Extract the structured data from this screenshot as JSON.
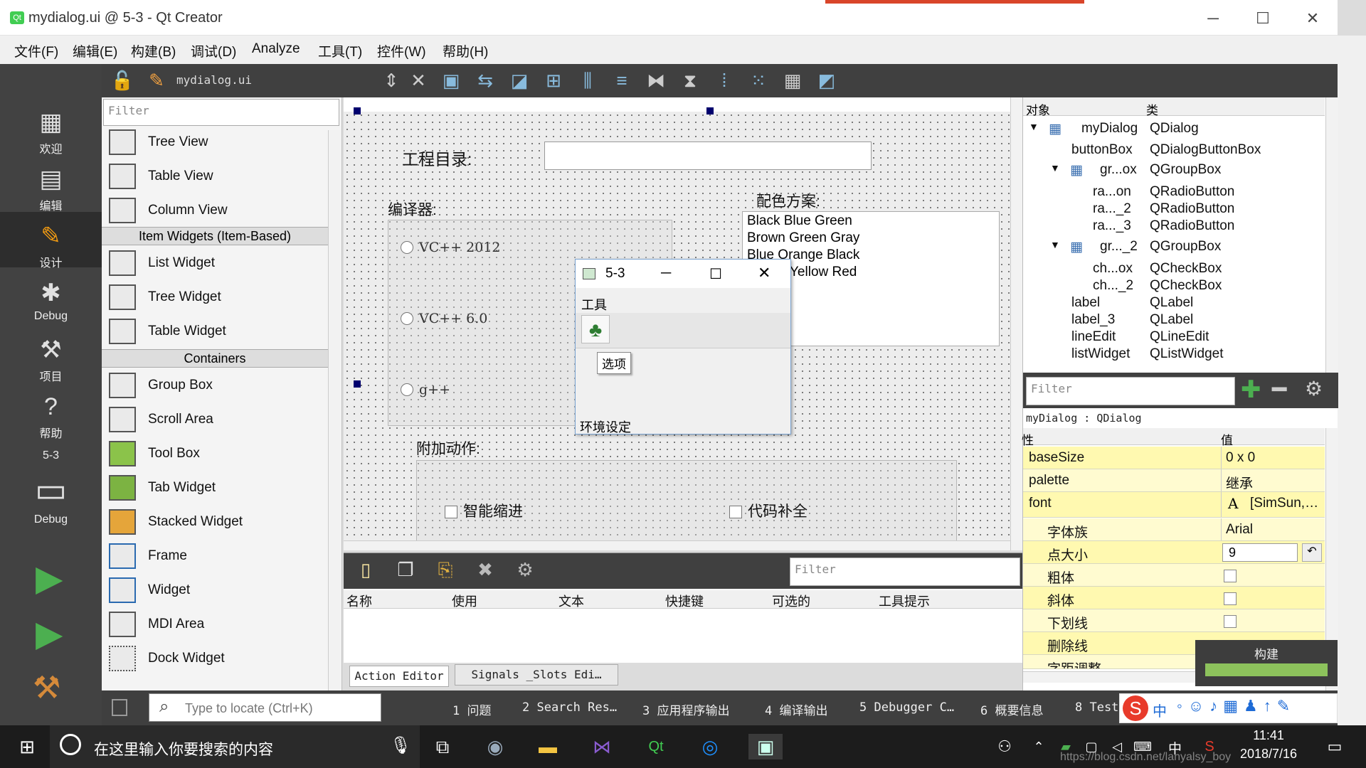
{
  "window": {
    "title": "mydialog.ui @ 5-3 - Qt Creator",
    "app_icon": "qt-icon",
    "minimize": "─",
    "maximize": "☐",
    "close": "✕"
  },
  "menu": [
    "文件(F)",
    "编辑(E)",
    "构建(B)",
    "调试(D)",
    "Analyze",
    "工具(T)",
    "控件(W)",
    "帮助(H)"
  ],
  "modes": [
    {
      "label": "欢迎",
      "icon": "grid-icon"
    },
    {
      "label": "编辑",
      "icon": "document-icon"
    },
    {
      "label": "设计",
      "icon": "pencil-icon"
    },
    {
      "label": "Debug",
      "icon": "bug-icon"
    },
    {
      "label": "项目",
      "icon": "wrench-icon"
    },
    {
      "label": "帮助",
      "icon": "help-icon"
    }
  ],
  "kit": {
    "project": "5-3",
    "label": "Debug"
  },
  "toolbar": {
    "file": "mydialog.ui"
  },
  "widgetbox": {
    "filter_placeholder": "Filter",
    "items_top": [
      "Tree View",
      "Table View",
      "Column View"
    ],
    "cat_item": "Item Widgets (Item-Based)",
    "items_mid": [
      "List Widget",
      "Tree Widget",
      "Table Widget"
    ],
    "cat_cont": "Containers",
    "items_cont": [
      "Group Box",
      "Scroll Area",
      "Tool Box",
      "Tab Widget",
      "Stacked Widget",
      "Frame",
      "Widget",
      "MDI Area",
      "Dock Widget"
    ]
  },
  "form": {
    "project_dir_label": "工程目录:",
    "compiler_label": "编译器:",
    "radios": [
      "VC++  2012",
      "VC++  6.0",
      "g++"
    ],
    "color_label": "配色方案:",
    "color_list": [
      "Black Blue Green",
      "Brown Green Gray",
      "Blue Orange Black",
      "Yellow Red"
    ],
    "extra_label": "附加动作:",
    "checks": [
      "智能缩进",
      "代码补全"
    ]
  },
  "popup": {
    "title": "5-3",
    "tool_title": "工具",
    "option_btn": "选项",
    "footer": "环境设定"
  },
  "action_editor": {
    "filter_placeholder": "Filter",
    "columns": [
      "名称",
      "使用",
      "文本",
      "快捷键",
      "可选的",
      "工具提示"
    ],
    "tabs": [
      "Action Editor",
      "Signals _Slots Edi…"
    ]
  },
  "objects": {
    "headers": [
      "对象",
      "类"
    ],
    "rows": [
      {
        "name": "myDialog",
        "cls": "QDialog"
      },
      {
        "name": "buttonBox",
        "cls": "QDialogButtonBox"
      },
      {
        "name": "gr...ox",
        "cls": "QGroupBox"
      },
      {
        "name": "ra...on",
        "cls": "QRadioButton"
      },
      {
        "name": "ra..._2",
        "cls": "QRadioButton"
      },
      {
        "name": "ra..._3",
        "cls": "QRadioButton"
      },
      {
        "name": "gr..._2",
        "cls": "QGroupBox"
      },
      {
        "name": "ch...ox",
        "cls": "QCheckBox"
      },
      {
        "name": "ch..._2",
        "cls": "QCheckBox"
      },
      {
        "name": "label",
        "cls": "QLabel"
      },
      {
        "name": "label_3",
        "cls": "QLabel"
      },
      {
        "name": "lineEdit",
        "cls": "QLineEdit"
      },
      {
        "name": "listWidget",
        "cls": "QListWidget"
      }
    ]
  },
  "props": {
    "filter_placeholder": "Filter",
    "context": "myDialog : QDialog",
    "headers": [
      "性",
      "值"
    ],
    "rows": [
      {
        "n": "baseSize",
        "v": "0 x 0"
      },
      {
        "n": "palette",
        "v": "继承"
      },
      {
        "n": "font",
        "v": "[SimSun,…"
      },
      {
        "n": "字体族",
        "v": "Arial"
      },
      {
        "n": "点大小",
        "v": "9"
      },
      {
        "n": "粗体",
        "v": ""
      },
      {
        "n": "斜体",
        "v": ""
      },
      {
        "n": "下划线",
        "v": ""
      },
      {
        "n": "删除线",
        "v": ""
      },
      {
        "n": "字距调整",
        "v": ""
      }
    ]
  },
  "build": {
    "label": "构建"
  },
  "statusbar": {
    "locator_placeholder": "Type to locate (Ctrl+K)",
    "panes": [
      "1  问题",
      "2  Search Res…",
      "3  应用程序输出",
      "4  编译输出",
      "5  Debugger C…",
      "6  概要信息",
      "8  Test"
    ]
  },
  "taskbar": {
    "search_placeholder": "在这里输入你要搜索的内容",
    "time": "11:41",
    "date": "2018/7/16",
    "ime": "中",
    "watermark": "https://blog.csdn.net/lanyalsy_boy"
  }
}
